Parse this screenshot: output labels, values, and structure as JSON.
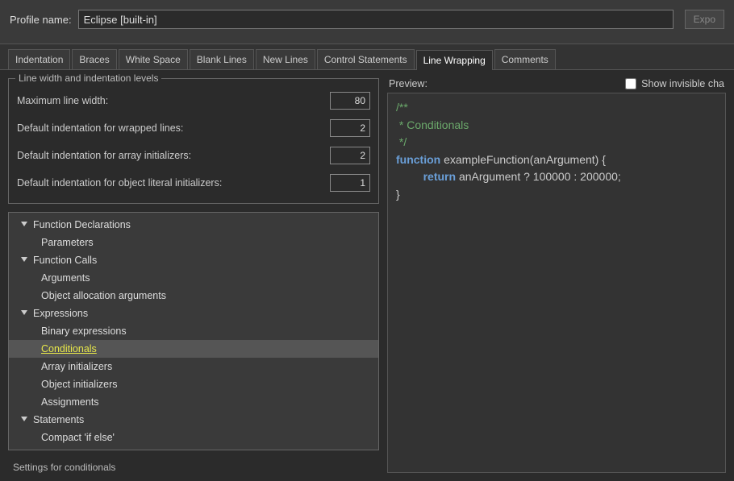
{
  "profile": {
    "label": "Profile name:",
    "value": "Eclipse [built-in]",
    "export_btn": "Expo"
  },
  "tabs": [
    "Indentation",
    "Braces",
    "White Space",
    "Blank Lines",
    "New Lines",
    "Control Statements",
    "Line Wrapping",
    "Comments"
  ],
  "active_tab_index": 6,
  "fieldset_label": "Line width and indentation levels",
  "settings": {
    "max_line_width": {
      "label": "Maximum line width:",
      "value": "80"
    },
    "indent_wrapped": {
      "label": "Default indentation for wrapped lines:",
      "value": "2"
    },
    "indent_array": {
      "label": "Default indentation for array initializers:",
      "value": "2"
    },
    "indent_object": {
      "label": "Default indentation for object literal initializers:",
      "value": "1"
    }
  },
  "tree": [
    {
      "label": "Function Declarations",
      "type": "parent"
    },
    {
      "label": "Parameters",
      "type": "child"
    },
    {
      "label": "Function Calls",
      "type": "parent"
    },
    {
      "label": "Arguments",
      "type": "child"
    },
    {
      "label": "Object allocation arguments",
      "type": "child"
    },
    {
      "label": "Expressions",
      "type": "parent"
    },
    {
      "label": "Binary expressions",
      "type": "child"
    },
    {
      "label": "Conditionals",
      "type": "child",
      "selected": true
    },
    {
      "label": "Array initializers",
      "type": "child"
    },
    {
      "label": "Object initializers",
      "type": "child"
    },
    {
      "label": "Assignments",
      "type": "child"
    },
    {
      "label": "Statements",
      "type": "parent"
    },
    {
      "label": "Compact 'if else'",
      "type": "child"
    }
  ],
  "settings_for": "Settings for conditionals",
  "preview": {
    "label": "Preview:",
    "show_invisible_label": "Show invisible cha",
    "show_invisible_checked": false,
    "code": {
      "line1": "/**",
      "line2": " * Conditionals",
      "line3": " */",
      "kw_function": "function",
      "fn_name": " exampleFunction(anArgument) {",
      "kw_return": "return",
      "ret_expr": " anArgument ? 100000 : 200000;",
      "close": "}"
    }
  }
}
